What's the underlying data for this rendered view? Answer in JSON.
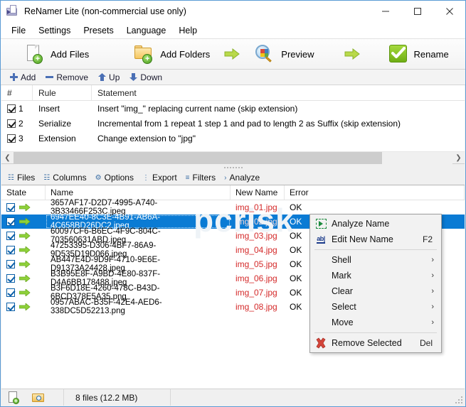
{
  "window": {
    "title": "ReNamer Lite (non-commercial use only)",
    "icon": "renamer-app-icon",
    "controls": {
      "minimize": "–",
      "maximize": "□",
      "close": "✕"
    }
  },
  "menubar": {
    "items": [
      {
        "label": "File"
      },
      {
        "label": "Settings"
      },
      {
        "label": "Presets"
      },
      {
        "label": "Language"
      },
      {
        "label": "Help"
      }
    ]
  },
  "toolbar": {
    "buttons": [
      {
        "label": "Add Files",
        "icon": "add-file-icon"
      },
      {
        "label": "Add Folders",
        "icon": "add-folder-icon"
      },
      {
        "label": "Preview",
        "icon": "preview-icon"
      },
      {
        "label": "Rename",
        "icon": "rename-check-icon"
      }
    ],
    "separators": [
      "arrow-right-icon",
      "arrow-right-icon"
    ]
  },
  "rules_toolbar": {
    "buttons": [
      {
        "label": "Add",
        "icon": "plus-icon"
      },
      {
        "label": "Remove",
        "icon": "minus-icon"
      },
      {
        "label": "Up",
        "icon": "arrow-up-icon"
      },
      {
        "label": "Down",
        "icon": "arrow-down-icon"
      }
    ]
  },
  "rules_table": {
    "headers": {
      "num": "#",
      "rule": "Rule",
      "statement": "Statement"
    },
    "rows": [
      {
        "checked": true,
        "num": "1",
        "rule": "Insert",
        "statement": "Insert \"img_\" replacing current name (skip extension)"
      },
      {
        "checked": true,
        "num": "2",
        "rule": "Serialize",
        "statement": "Incremental from 1 repeat 1 step 1 and pad to length 2 as Suffix (skip extension)"
      },
      {
        "checked": true,
        "num": "3",
        "rule": "Extension",
        "statement": "Change extension to \"jpg\""
      }
    ]
  },
  "tabstrip": {
    "tabs": [
      {
        "label": "Files",
        "icon": "files-icon"
      },
      {
        "label": "Columns",
        "icon": "columns-icon"
      },
      {
        "label": "Options",
        "icon": "options-icon"
      },
      {
        "label": "Export",
        "icon": "export-icon"
      },
      {
        "label": "Filters",
        "icon": "filters-icon"
      },
      {
        "label": "Analyze",
        "icon": "analyze-icon"
      }
    ]
  },
  "file_table": {
    "headers": {
      "state": "State",
      "name": "Name",
      "new_name": "New Name",
      "error": "Error"
    },
    "rows": [
      {
        "checked": true,
        "name": "3657AF17-D2D7-4995-A740-3B33466F253C.jpeg",
        "new_name": "img_01.jpg",
        "error": "OK",
        "selected": false
      },
      {
        "checked": true,
        "name": "6947EE40-8C3E-4B91-AB6A-4C658BD26DC2.jpeg",
        "new_name": "img_02.jpg",
        "error": "OK",
        "selected": true
      },
      {
        "checked": true,
        "name": "60097CF6-B6EC-4F9C-804C-703560631ABD.jpeg",
        "new_name": "img_03.jpg",
        "error": "OK",
        "selected": false
      },
      {
        "checked": true,
        "name": "47253395-D306-4BF7-86A9-9D535D19D066.jpeg",
        "new_name": "img_04.jpg",
        "error": "OK",
        "selected": false
      },
      {
        "checked": true,
        "name": "AB447E4D-9D9F-4710-9E6E-D91373A24428.jpeg",
        "new_name": "img_05.jpg",
        "error": "OK",
        "selected": false
      },
      {
        "checked": true,
        "name": "B3B95E8F-A9BD-4E80-837F-D4A6BB178488.jpeg",
        "new_name": "img_06.jpg",
        "error": "OK",
        "selected": false
      },
      {
        "checked": true,
        "name": "B3F6D18E-4260-478C-B43D-6BCD378E5A35.png",
        "new_name": "img_07.jpg",
        "error": "OK",
        "selected": false
      },
      {
        "checked": true,
        "name": "0957ABAC-B35F-42E4-AED6-338DC5D52213.png",
        "new_name": "img_08.jpg",
        "error": "OK",
        "selected": false
      }
    ]
  },
  "context_menu": {
    "items": [
      {
        "label": "Analyze Name",
        "accel": "",
        "icon": "analyze-name-icon",
        "submenu": false
      },
      {
        "label": "Edit New Name",
        "accel": "F2",
        "icon": "edit-text-icon",
        "submenu": false
      },
      {
        "separator": true
      },
      {
        "label": "Shell",
        "accel": "",
        "icon": "",
        "submenu": true
      },
      {
        "label": "Mark",
        "accel": "",
        "icon": "",
        "submenu": true
      },
      {
        "label": "Clear",
        "accel": "",
        "icon": "",
        "submenu": true
      },
      {
        "label": "Select",
        "accel": "",
        "icon": "",
        "submenu": true
      },
      {
        "label": "Move",
        "accel": "",
        "icon": "",
        "submenu": true
      },
      {
        "separator": true
      },
      {
        "label": "Remove Selected",
        "accel": "Del",
        "icon": "remove-x-icon",
        "submenu": false
      }
    ],
    "submenu_arrow": "›"
  },
  "statusbar": {
    "files_summary": "8 files (12.2 MB)",
    "icons": [
      "add-file-status-icon",
      "find-folder-status-icon"
    ]
  },
  "colors": {
    "selection_blue": "#0a7bd4",
    "new_name_red": "#d42a2a",
    "accent_green": "#6fae14",
    "window_border": "#5b9bd5",
    "chrome_gray": "#f0f0f0"
  },
  "watermark": "pcrisk"
}
